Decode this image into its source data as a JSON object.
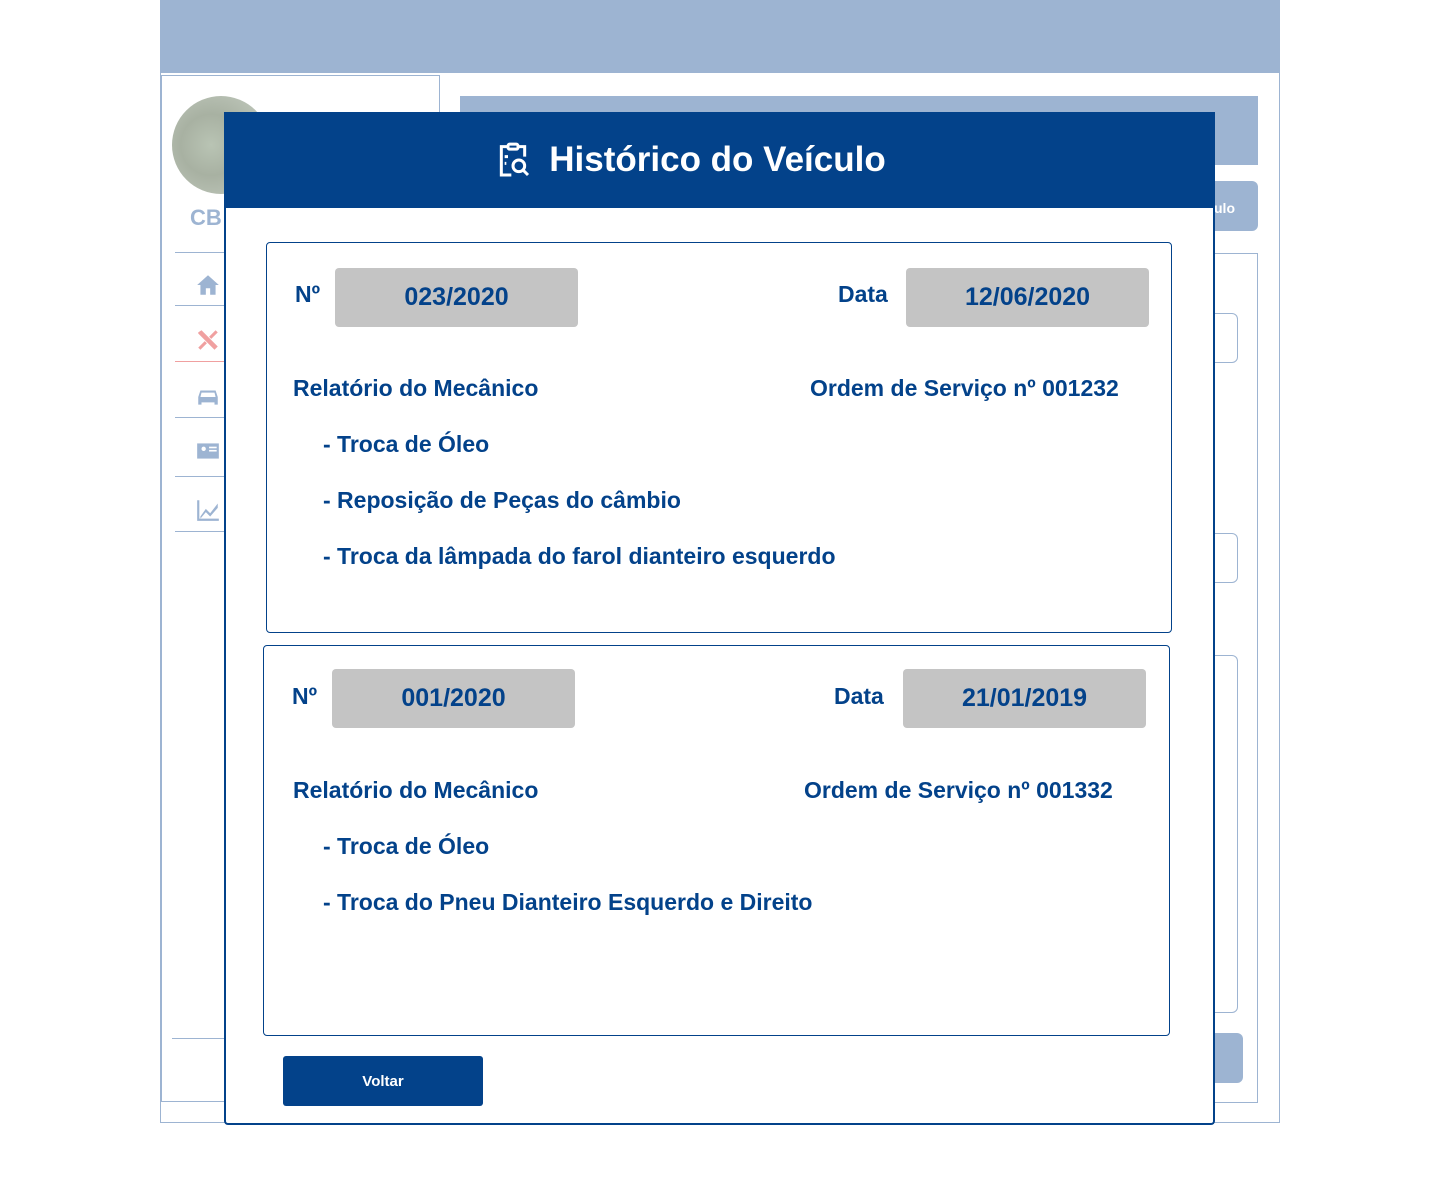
{
  "background": {
    "sidebar": {
      "user_initials": "CB",
      "nav_icons": [
        "home-icon",
        "tools-icon",
        "car-icon",
        "id-card-icon",
        "chart-icon"
      ]
    },
    "action_button_partial_label": "ulo"
  },
  "modal": {
    "title": "Histórico do Veículo",
    "title_icon": "clipboard-search-icon",
    "records": [
      {
        "number_label": "Nº",
        "number": "023/2020",
        "date_label": "Data",
        "date": "12/06/2020",
        "report_label": "Relatório do Mecânico",
        "service_order": "Ordem de Serviço nº 001232",
        "items": [
          "- Troca de Óleo",
          "- Reposição de Peças do câmbio",
          "- Troca da lâmpada do farol dianteiro esquerdo"
        ]
      },
      {
        "number_label": "Nº",
        "number": "001/2020",
        "date_label": "Data",
        "date": "21/01/2019",
        "report_label": "Relatório do Mecânico",
        "service_order": "Ordem de Serviço nº 001332",
        "items": [
          "- Troca de Óleo",
          "- Troca do Pneu Dianteiro Esquerdo e Direito"
        ]
      }
    ],
    "back_button": "Voltar"
  },
  "colors": {
    "primary": "#03428a",
    "faded": "#9db4d2",
    "pill": "#c4c4c4",
    "active_nav": "#f0a0a0"
  }
}
